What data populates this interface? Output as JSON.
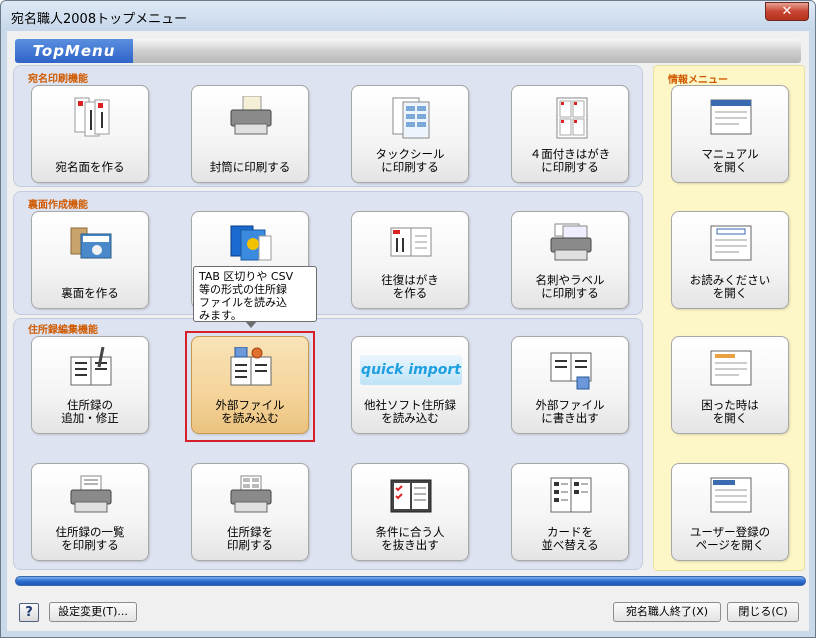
{
  "window": {
    "title": "宛名職人2008トップメニュー",
    "close_glyph": "✕"
  },
  "banner": {
    "label": "TopMenu"
  },
  "sections": {
    "address_print": "宛名印刷機能",
    "back_create": "裏面作成機能",
    "addressbook_edit": "住所録編集機能",
    "info_menu": "情報メニュー"
  },
  "tiles": {
    "address_side": "宛名面を作る",
    "envelope": "封筒に印刷する",
    "tack_seal": "タックシール\nに印刷する",
    "four_postcard": "４面付きはがき\nに印刷する",
    "back_side": "裏面を作る",
    "return_postcard": "往復はがき\nを作る",
    "business_card": "名刺やラベル\nに印刷する",
    "add_edit": "住所録の\n追加・修正",
    "import_external": "外部ファイル\nを読み込む",
    "import_other": "他社ソフト住所録\nを読み込む",
    "export_external": "外部ファイル\nに書き出す",
    "print_list": "住所録の一覧\nを印刷する",
    "print_addressbook": "住所録を\n印刷する",
    "extract_matching": "条件に合う人\nを抜き出す",
    "sort_cards": "カードを\n並べ替える",
    "manual": "マニュアル\nを開く",
    "readme": "お読みください\nを開く",
    "trouble": "困った時は\nを開く",
    "registration": "ユーザー登録の\nページを開く"
  },
  "quick_import_logo": "quick import",
  "tooltip": {
    "text": "TAB 区切りや CSV\n等の形式の住所録\nファイルを読み込\nみます。"
  },
  "footer": {
    "help": "?",
    "settings": "設定変更(T)...",
    "quit": "宛名職人終了(X)",
    "close": "閉じる(C)"
  },
  "colors": {
    "accent": "#2f63c8",
    "section_title": "#d05a00",
    "selection": "#d8202a",
    "info_bg": "#fdf7c8"
  }
}
